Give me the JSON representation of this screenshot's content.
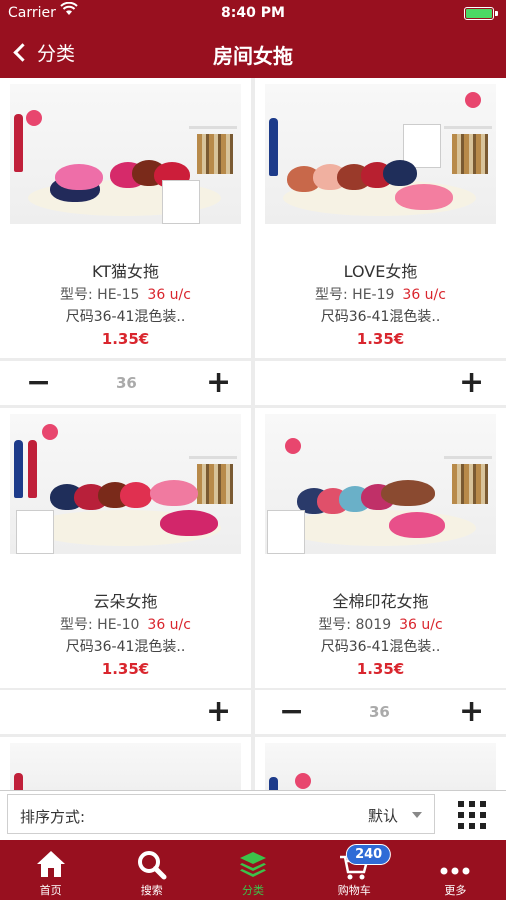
{
  "status": {
    "carrier": "Carrier",
    "time": "8:40 PM"
  },
  "nav": {
    "back_label": "分类",
    "title": "房间女拖"
  },
  "products": [
    {
      "name": "KT猫女拖",
      "model": "型号: HE-15",
      "unit": "36 u/c",
      "size": "尺码36-41混色装..",
      "price": "1.35€"
    },
    {
      "name": "LOVE女拖",
      "model": "型号: HE-19",
      "unit": "36 u/c",
      "size": "尺码36-41混色装..",
      "price": "1.35€"
    },
    {
      "name": "云朵女拖",
      "model": "型号: HE-10",
      "unit": "36 u/c",
      "size": "尺码36-41混色装..",
      "price": "1.35€"
    },
    {
      "name": "全棉印花女拖",
      "model": "型号: 8019",
      "unit": "36 u/c",
      "size": "尺码36-41混色装..",
      "price": "1.35€"
    }
  ],
  "quantities": {
    "p1": "36",
    "p4": "36"
  },
  "controls": {
    "minus": "−",
    "plus": "+"
  },
  "sort": {
    "label": "排序方式:",
    "value": "默认"
  },
  "tabs": [
    {
      "label": "首页",
      "icon": "home-icon"
    },
    {
      "label": "搜索",
      "icon": "search-icon"
    },
    {
      "label": "分类",
      "icon": "layers-icon"
    },
    {
      "label": "购物车",
      "icon": "cart-icon",
      "badge": "240"
    },
    {
      "label": "更多",
      "icon": "more-icon"
    }
  ],
  "colors": {
    "brand": "#98101f",
    "price": "#d9262e",
    "active_tab": "#3cc24a",
    "badge": "#2f6bd6"
  }
}
